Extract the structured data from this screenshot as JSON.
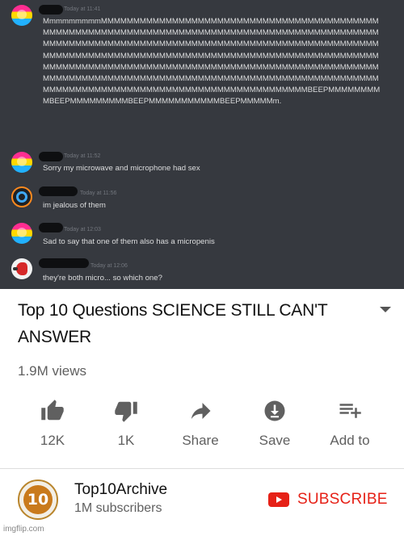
{
  "chat": {
    "messages": [
      {
        "avatar": "pansexual-flag-avatar",
        "timestamp": "Today at 11:41",
        "text": "MmmmmmmmmMMMMMMMMMMMMMMMMMMMMMMMMMMMMMMMMMMMMMMMMMMMMMMMMMMMMMMMMMMMMMMMMMMMMMMMMMMMMMMMMMMMMMMMMMMMMMMMMMMMMMMMMMMMMMMMMMMMMMMMMMMMMMMMMMMMMMMMMMMMMMMMMMMMMMMMMMMMMMMMMMMMMMMMMMMMMMMMMMMMMMMMMMMMMMMMMMMMMMMMMMMMMMMMMMMMMMMMMMMMMMMMMMMMMMMMMMMMMMMMMMMMMMMMMMMMMMMMMMMMMMMMMMMMMMMMMMMMMMMMMMMMMMMMMMMMMMMMMMMMMMMMMMMMMMMMMMMMMMMMMMMMMMMMMMMMMMMMMMMMMMMMMBEEPMMMMMMMMMBEEPMMMMMMMMMBEEPMMMMMMMMMMMBEEPMMMMMm."
      },
      {
        "avatar": "pansexual-flag-avatar",
        "timestamp": "Today at 11:52",
        "text": "Sorry my microwave and microphone had sex"
      },
      {
        "avatar": "portal-avatar",
        "timestamp": "Today at 11:56",
        "text": "im jealous of them"
      },
      {
        "avatar": "pansexual-flag-avatar",
        "timestamp": "Today at 12:03",
        "text": "Sad to say that one of them also has a micropenis"
      },
      {
        "avatar": "red-bird-avatar",
        "timestamp": "Today at 12:06",
        "text": "they're both micro... so which one?"
      }
    ]
  },
  "video": {
    "title": "Top 10 Questions SCIENCE STILL CAN'T ANSWER",
    "views": "1.9M views",
    "actions": [
      {
        "icon": "thumbs-up-icon",
        "label": "12K"
      },
      {
        "icon": "thumbs-down-icon",
        "label": "1K"
      },
      {
        "icon": "share-icon",
        "label": "Share"
      },
      {
        "icon": "save-icon",
        "label": "Save"
      },
      {
        "icon": "add-to-playlist-icon",
        "label": "Add to"
      }
    ]
  },
  "channel": {
    "logo_text": "10",
    "name": "Top10Archive",
    "subscribers": "1M subscribers",
    "subscribe_label": "SUBSCRIBE"
  },
  "watermark": "imgflip.com",
  "colors": {
    "discord_bg": "#36393f",
    "youtube_red": "#e62117",
    "muted_text": "#606060"
  }
}
